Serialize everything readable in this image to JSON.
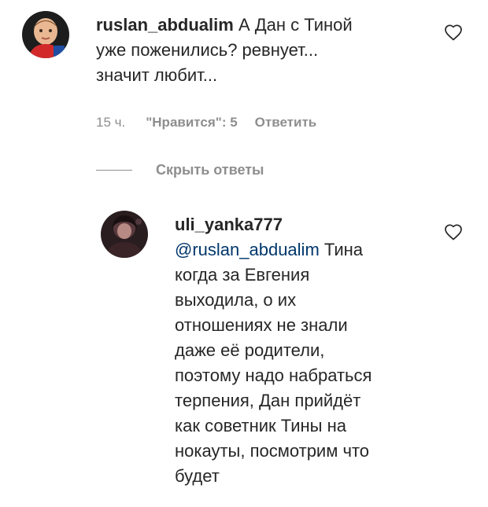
{
  "comments": [
    {
      "username": "ruslan_abdualim",
      "text_line1": " А Дан с Тиной",
      "text_line2": "уже поженились? ревнует...",
      "text_line3": "значит любит...",
      "time": "15 ч.",
      "likes": "\"Нравится\": 5",
      "reply_label": "Ответить",
      "like_icon": "heart-outline-icon"
    }
  ],
  "hide_replies_label": "Скрыть ответы",
  "reply": {
    "username": "uli_yanka777",
    "mention": "@ruslan_abdualim",
    "lines": [
      " Тина",
      "когда за Евгения",
      "выходила, о их",
      "отношениях не знали",
      "даже её родители,",
      "поэтому надо набраться",
      "терпения, Дан прийдёт",
      "как советник Тины на",
      "нокауты, посмотрим что",
      "будет"
    ],
    "like_icon": "heart-outline-icon"
  }
}
